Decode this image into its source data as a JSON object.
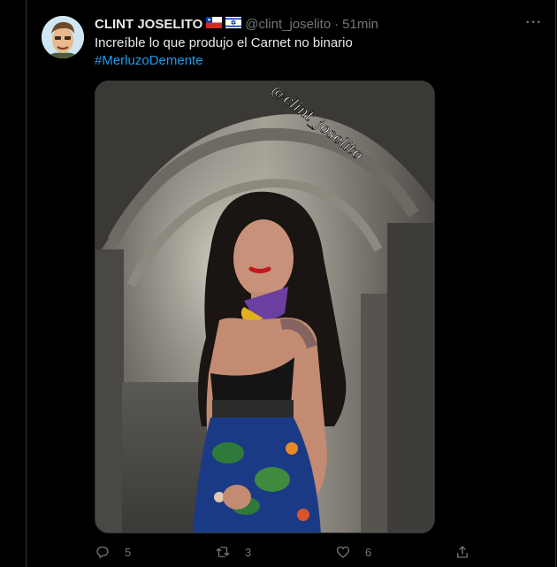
{
  "tweet": {
    "author_name": "CLINT JOSELITO",
    "handle": "@clint_joselito",
    "separator": "·",
    "time": "51min",
    "text": "Increíble lo que produjo el Carnet no binario",
    "hashtag": "#MerluzoDemente",
    "media_watermark": "@clint_joselito",
    "flags": [
      "chile-flag-icon",
      "israel-flag-icon"
    ]
  },
  "actions": {
    "reply_count": "5",
    "retweet_count": "3",
    "like_count": "6"
  },
  "colors": {
    "background": "#000000",
    "text": "#e7e9ea",
    "muted": "#71767b",
    "link": "#1d9bf0",
    "border": "#2f3336"
  }
}
